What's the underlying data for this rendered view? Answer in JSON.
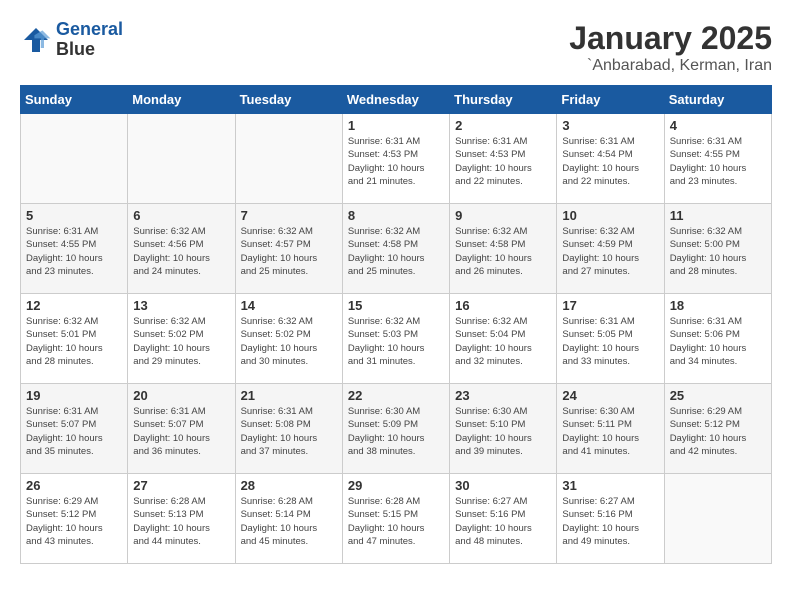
{
  "header": {
    "logo_line1": "General",
    "logo_line2": "Blue",
    "month": "January 2025",
    "location": "`Anbarabad, Kerman, Iran"
  },
  "days_of_week": [
    "Sunday",
    "Monday",
    "Tuesday",
    "Wednesday",
    "Thursday",
    "Friday",
    "Saturday"
  ],
  "weeks": [
    [
      {
        "day": "",
        "info": ""
      },
      {
        "day": "",
        "info": ""
      },
      {
        "day": "",
        "info": ""
      },
      {
        "day": "1",
        "info": "Sunrise: 6:31 AM\nSunset: 4:53 PM\nDaylight: 10 hours\nand 21 minutes."
      },
      {
        "day": "2",
        "info": "Sunrise: 6:31 AM\nSunset: 4:53 PM\nDaylight: 10 hours\nand 22 minutes."
      },
      {
        "day": "3",
        "info": "Sunrise: 6:31 AM\nSunset: 4:54 PM\nDaylight: 10 hours\nand 22 minutes."
      },
      {
        "day": "4",
        "info": "Sunrise: 6:31 AM\nSunset: 4:55 PM\nDaylight: 10 hours\nand 23 minutes."
      }
    ],
    [
      {
        "day": "5",
        "info": "Sunrise: 6:31 AM\nSunset: 4:55 PM\nDaylight: 10 hours\nand 23 minutes."
      },
      {
        "day": "6",
        "info": "Sunrise: 6:32 AM\nSunset: 4:56 PM\nDaylight: 10 hours\nand 24 minutes."
      },
      {
        "day": "7",
        "info": "Sunrise: 6:32 AM\nSunset: 4:57 PM\nDaylight: 10 hours\nand 25 minutes."
      },
      {
        "day": "8",
        "info": "Sunrise: 6:32 AM\nSunset: 4:58 PM\nDaylight: 10 hours\nand 25 minutes."
      },
      {
        "day": "9",
        "info": "Sunrise: 6:32 AM\nSunset: 4:58 PM\nDaylight: 10 hours\nand 26 minutes."
      },
      {
        "day": "10",
        "info": "Sunrise: 6:32 AM\nSunset: 4:59 PM\nDaylight: 10 hours\nand 27 minutes."
      },
      {
        "day": "11",
        "info": "Sunrise: 6:32 AM\nSunset: 5:00 PM\nDaylight: 10 hours\nand 28 minutes."
      }
    ],
    [
      {
        "day": "12",
        "info": "Sunrise: 6:32 AM\nSunset: 5:01 PM\nDaylight: 10 hours\nand 28 minutes."
      },
      {
        "day": "13",
        "info": "Sunrise: 6:32 AM\nSunset: 5:02 PM\nDaylight: 10 hours\nand 29 minutes."
      },
      {
        "day": "14",
        "info": "Sunrise: 6:32 AM\nSunset: 5:02 PM\nDaylight: 10 hours\nand 30 minutes."
      },
      {
        "day": "15",
        "info": "Sunrise: 6:32 AM\nSunset: 5:03 PM\nDaylight: 10 hours\nand 31 minutes."
      },
      {
        "day": "16",
        "info": "Sunrise: 6:32 AM\nSunset: 5:04 PM\nDaylight: 10 hours\nand 32 minutes."
      },
      {
        "day": "17",
        "info": "Sunrise: 6:31 AM\nSunset: 5:05 PM\nDaylight: 10 hours\nand 33 minutes."
      },
      {
        "day": "18",
        "info": "Sunrise: 6:31 AM\nSunset: 5:06 PM\nDaylight: 10 hours\nand 34 minutes."
      }
    ],
    [
      {
        "day": "19",
        "info": "Sunrise: 6:31 AM\nSunset: 5:07 PM\nDaylight: 10 hours\nand 35 minutes."
      },
      {
        "day": "20",
        "info": "Sunrise: 6:31 AM\nSunset: 5:07 PM\nDaylight: 10 hours\nand 36 minutes."
      },
      {
        "day": "21",
        "info": "Sunrise: 6:31 AM\nSunset: 5:08 PM\nDaylight: 10 hours\nand 37 minutes."
      },
      {
        "day": "22",
        "info": "Sunrise: 6:30 AM\nSunset: 5:09 PM\nDaylight: 10 hours\nand 38 minutes."
      },
      {
        "day": "23",
        "info": "Sunrise: 6:30 AM\nSunset: 5:10 PM\nDaylight: 10 hours\nand 39 minutes."
      },
      {
        "day": "24",
        "info": "Sunrise: 6:30 AM\nSunset: 5:11 PM\nDaylight: 10 hours\nand 41 minutes."
      },
      {
        "day": "25",
        "info": "Sunrise: 6:29 AM\nSunset: 5:12 PM\nDaylight: 10 hours\nand 42 minutes."
      }
    ],
    [
      {
        "day": "26",
        "info": "Sunrise: 6:29 AM\nSunset: 5:12 PM\nDaylight: 10 hours\nand 43 minutes."
      },
      {
        "day": "27",
        "info": "Sunrise: 6:28 AM\nSunset: 5:13 PM\nDaylight: 10 hours\nand 44 minutes."
      },
      {
        "day": "28",
        "info": "Sunrise: 6:28 AM\nSunset: 5:14 PM\nDaylight: 10 hours\nand 45 minutes."
      },
      {
        "day": "29",
        "info": "Sunrise: 6:28 AM\nSunset: 5:15 PM\nDaylight: 10 hours\nand 47 minutes."
      },
      {
        "day": "30",
        "info": "Sunrise: 6:27 AM\nSunset: 5:16 PM\nDaylight: 10 hours\nand 48 minutes."
      },
      {
        "day": "31",
        "info": "Sunrise: 6:27 AM\nSunset: 5:16 PM\nDaylight: 10 hours\nand 49 minutes."
      },
      {
        "day": "",
        "info": ""
      }
    ]
  ]
}
